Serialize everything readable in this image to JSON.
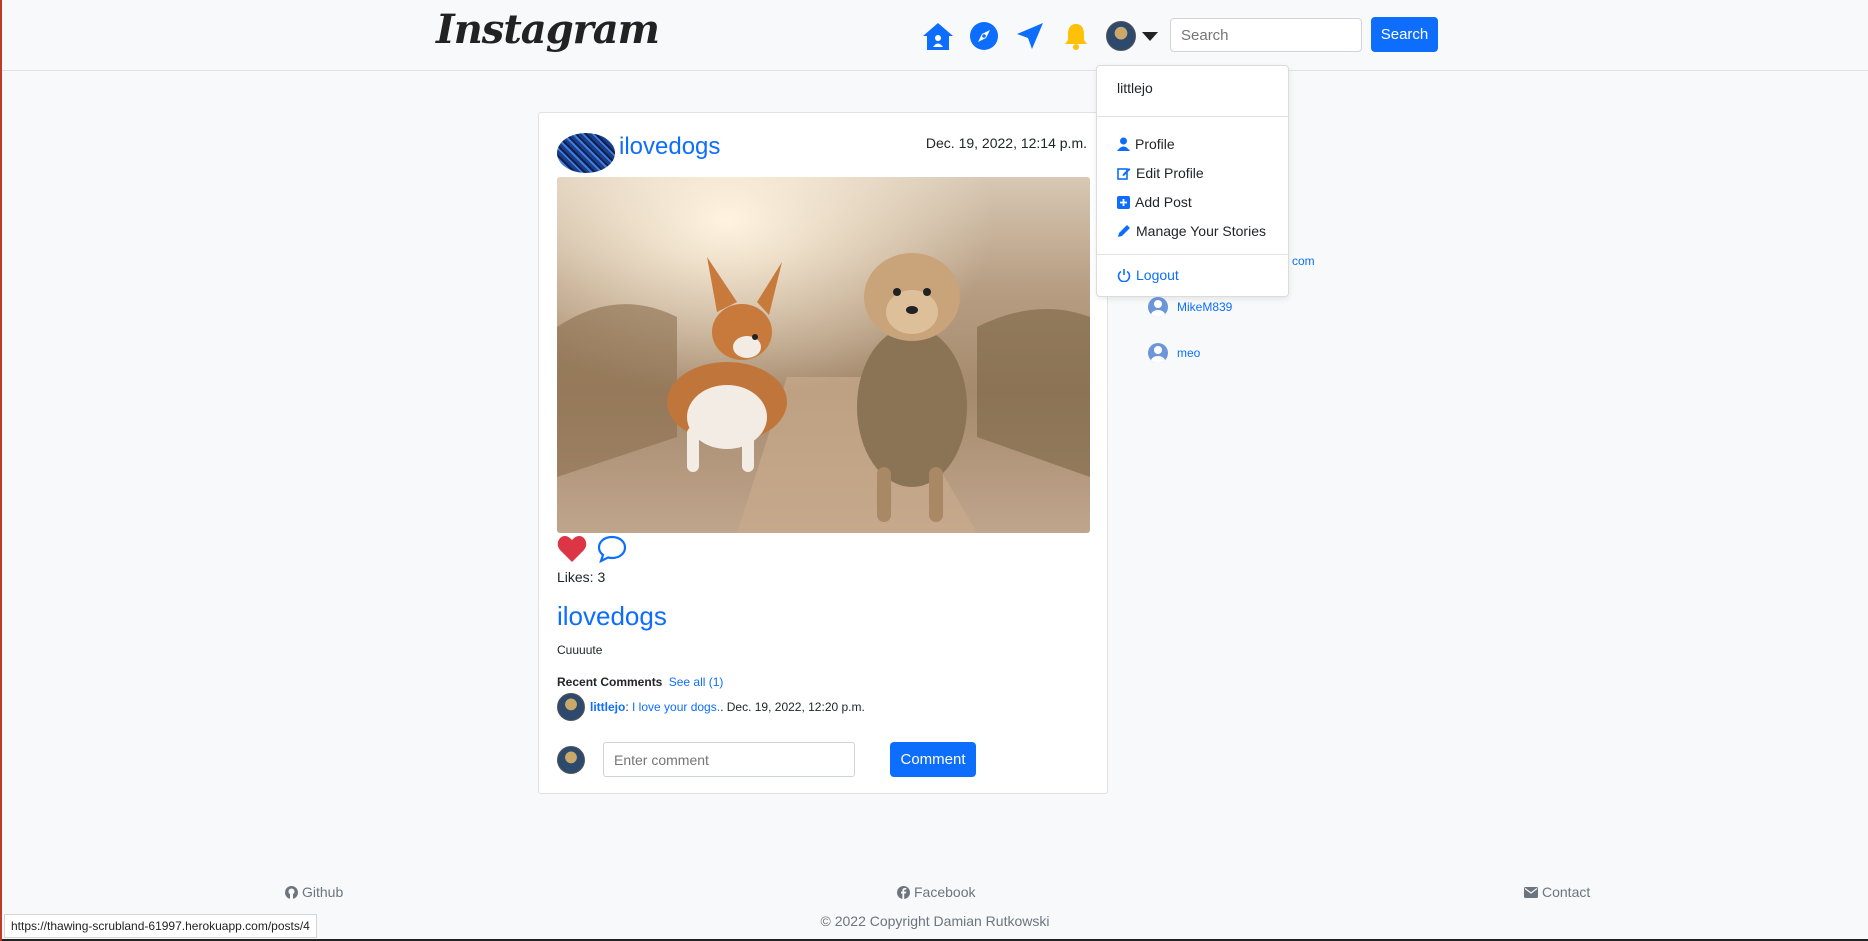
{
  "nav": {
    "logo": "Instagram",
    "search_placeholder": "Search",
    "search_button": "Search"
  },
  "dropdown": {
    "username": "littlejo",
    "items": [
      {
        "label": "Profile",
        "icon": "person-icon"
      },
      {
        "label": "Edit Profile",
        "icon": "edit-icon"
      },
      {
        "label": "Add Post",
        "icon": "plus-square-icon"
      },
      {
        "label": "Manage Your Stories",
        "icon": "pencil-icon"
      }
    ],
    "logout": "Logout"
  },
  "suggestions": {
    "partial_tail": "com",
    "users": [
      "MikeM839",
      "meo"
    ]
  },
  "post": {
    "username": "ilovedogs",
    "date": "Dec. 19, 2022, 12:14 p.m.",
    "likes": "Likes: 3",
    "title": "ilovedogs",
    "caption": "Cuuuute",
    "recent_label": "Recent Comments",
    "see_all": "See all (1)",
    "comment": {
      "user": "littlejo",
      "text": "I love your dogs.",
      "date": ". Dec. 19, 2022, 12:20 p.m."
    },
    "comment_placeholder": "Enter comment",
    "comment_button": "Comment"
  },
  "footer": {
    "github": "Github",
    "facebook": "Facebook",
    "contact": "Contact",
    "copyright": "© 2022 Copyright Damian Rutkowski"
  },
  "status_url": "https://thawing-scrubland-61997.herokuapp.com/posts/4",
  "colors": {
    "accent": "#0d6efd",
    "like": "#dc3545",
    "bell": "#ffc107"
  }
}
